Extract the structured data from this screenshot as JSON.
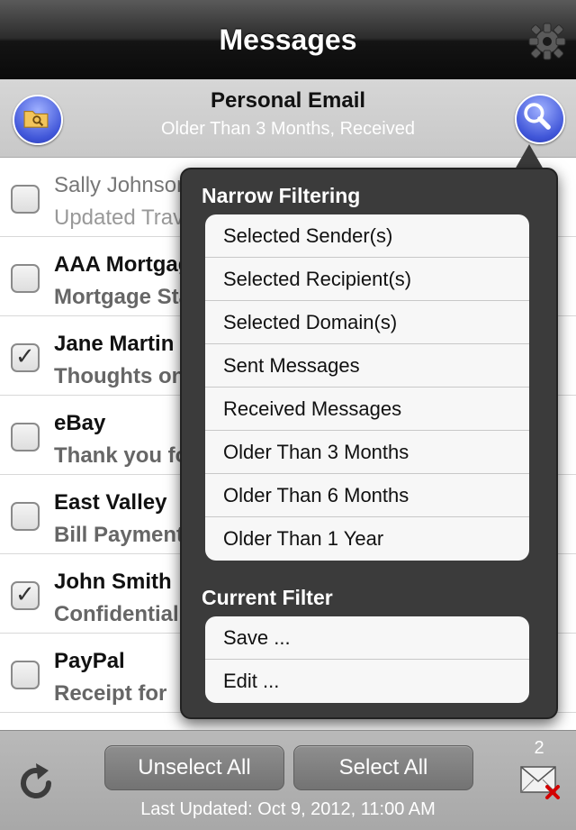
{
  "navbar": {
    "title": "Messages",
    "settings_icon": "gear-icon"
  },
  "filter_header": {
    "title": "Personal Email",
    "subtitle": "Older Than 3 Months, Received",
    "left_icon": "folder-search-icon",
    "right_icon": "search-icon"
  },
  "messages": [
    {
      "sender": "Sally Johnson",
      "subject": "Updated Travel Plans",
      "checked": false,
      "read": true
    },
    {
      "sender": "AAA Mortgage",
      "subject": "Mortgage Statement",
      "checked": false,
      "read": false
    },
    {
      "sender": "Jane Martin",
      "subject": "Thoughts on",
      "checked": true,
      "read": false
    },
    {
      "sender": "eBay",
      "subject": "Thank you for",
      "checked": false,
      "read": false
    },
    {
      "sender": "East Valley",
      "subject": "Bill Payment",
      "checked": false,
      "read": false
    },
    {
      "sender": "John Smith",
      "subject": "Confidential",
      "checked": true,
      "read": false
    },
    {
      "sender": "PayPal",
      "subject": "Receipt for",
      "checked": false,
      "read": false
    }
  ],
  "popover": {
    "narrow_title": "Narrow Filtering",
    "narrow_items": [
      "Selected Sender(s)",
      "Selected Recipient(s)",
      "Selected Domain(s)",
      "Sent Messages",
      "Received Messages",
      "Older Than 3 Months",
      "Older Than 6 Months",
      "Older Than 1 Year"
    ],
    "current_title": "Current Filter",
    "current_items": [
      "Save ...",
      "Edit ..."
    ]
  },
  "toolbar": {
    "unselect_all": "Unselect All",
    "select_all": "Select All",
    "last_updated": "Last Updated: Oct 9, 2012, 11:00 AM",
    "badge_count": "2",
    "refresh_icon": "refresh-icon",
    "delete_mail_icon": "mail-delete-icon"
  },
  "colors": {
    "accent_blue": "#3f55d8",
    "popover_bg": "#3b3b3b"
  }
}
